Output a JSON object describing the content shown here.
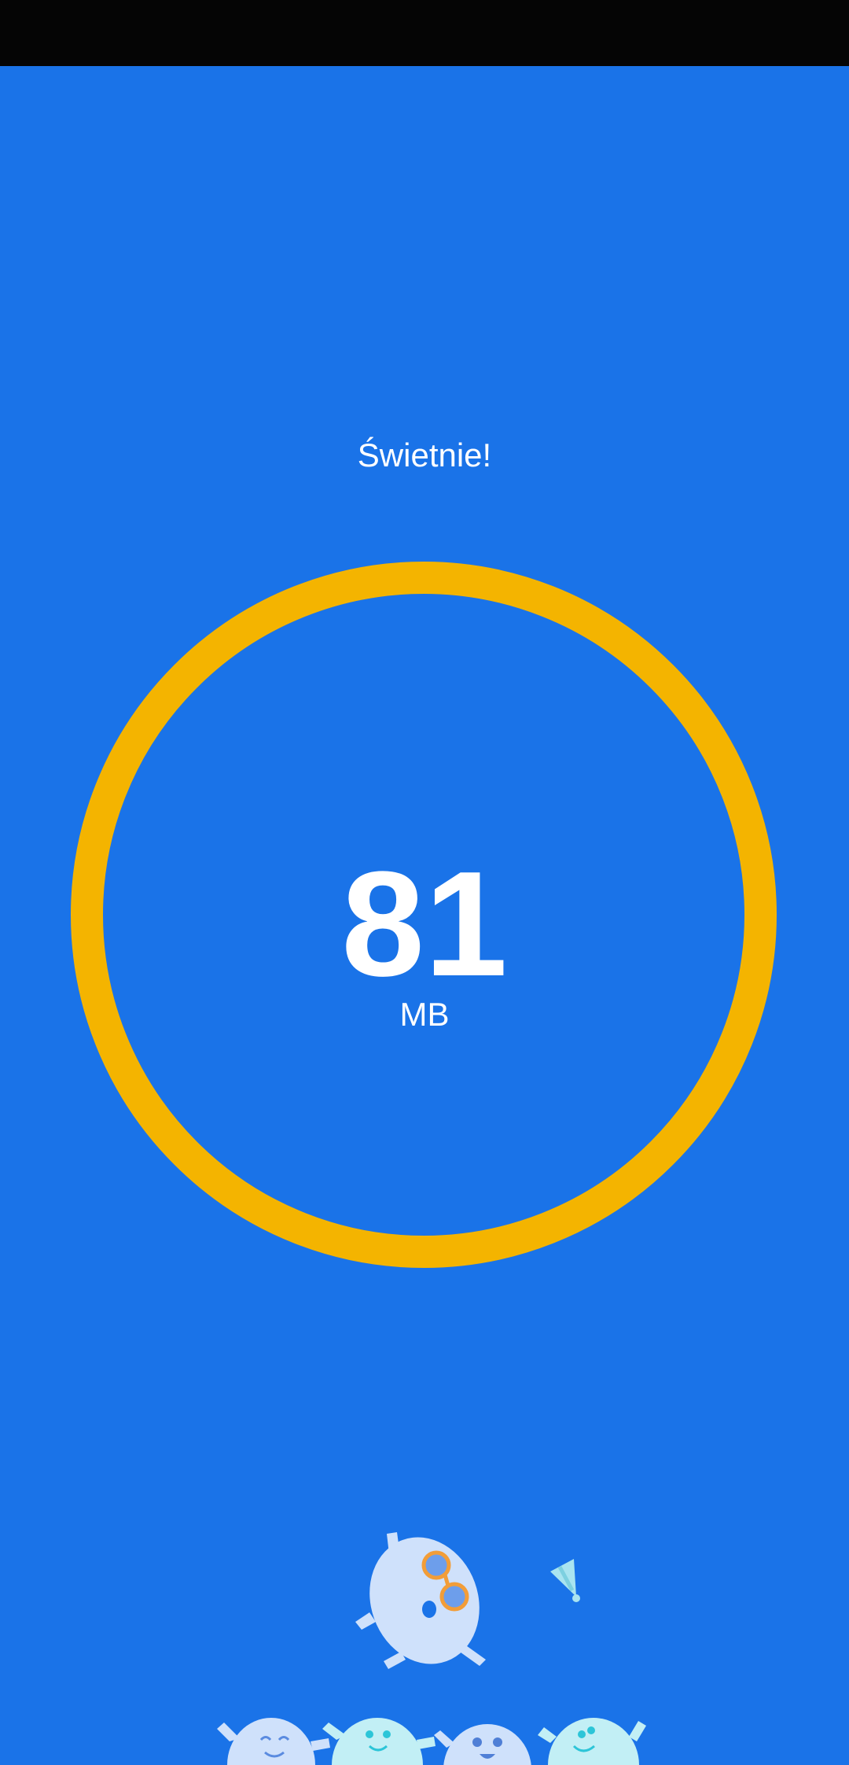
{
  "result": {
    "headline": "Świetnie!",
    "amount": "81",
    "unit": "MB"
  },
  "colors": {
    "background": "#1a73e8",
    "ring": "#f4b400",
    "status_bar": "#050505"
  },
  "illustration": {
    "description_icon": "celebrating-characters-illustration"
  }
}
